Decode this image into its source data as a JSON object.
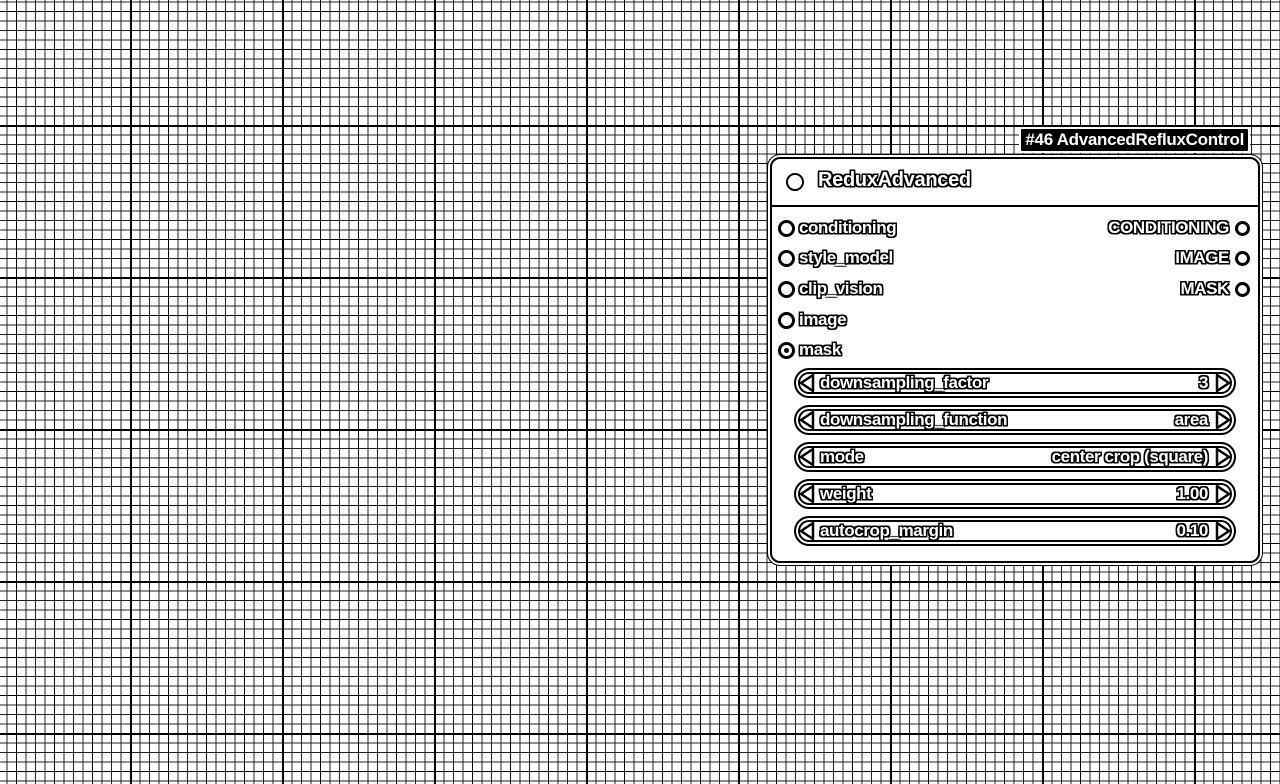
{
  "node": {
    "id_label": "#46 AdvancedRefluxControl",
    "title": "ReduxAdvanced",
    "inputs": [
      {
        "label": "conditioning"
      },
      {
        "label": "style_model"
      },
      {
        "label": "clip_vision"
      },
      {
        "label": "image"
      },
      {
        "label": "mask"
      }
    ],
    "outputs": [
      {
        "label": "CONDITIONING"
      },
      {
        "label": "IMAGE"
      },
      {
        "label": "MASK"
      }
    ],
    "widgets": [
      {
        "label": "downsampling_factor",
        "value": "3"
      },
      {
        "label": "downsampling_function",
        "value": "area"
      },
      {
        "label": "mode",
        "value": "center crop (square)"
      },
      {
        "label": "weight",
        "value": "1.00"
      },
      {
        "label": "autocrop_margin",
        "value": "0.10"
      }
    ]
  }
}
